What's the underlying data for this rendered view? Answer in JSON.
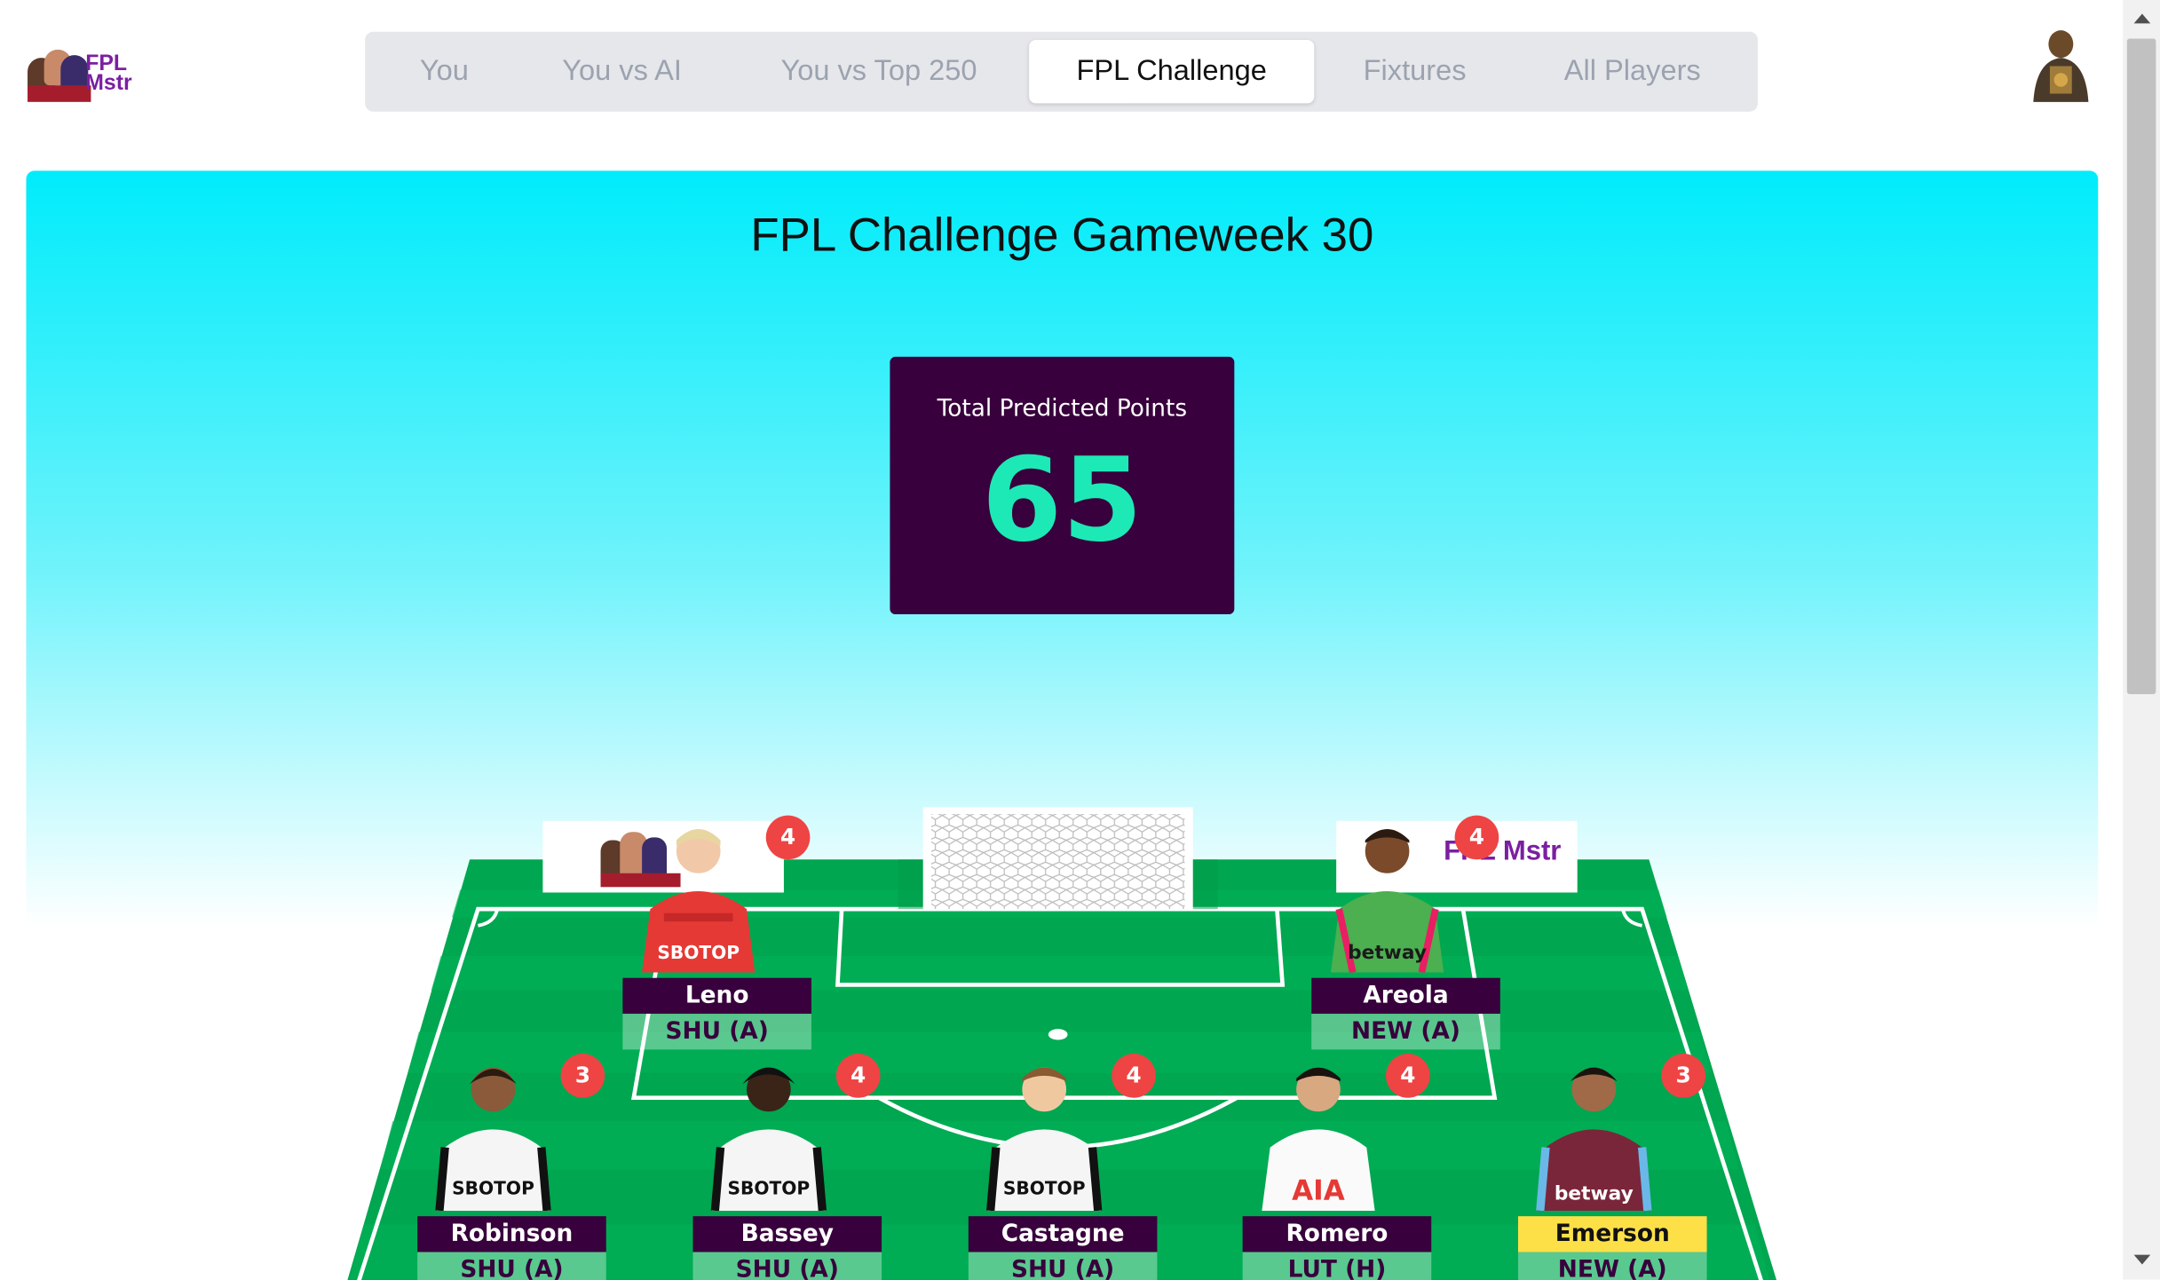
{
  "brand": {
    "logo_text": "FPL Mstr"
  },
  "nav": {
    "tabs": [
      {
        "label": "You",
        "active": false
      },
      {
        "label": "You vs AI",
        "active": false
      },
      {
        "label": "You vs Top 250",
        "active": false
      },
      {
        "label": "FPL Challenge",
        "active": true
      },
      {
        "label": "Fixtures",
        "active": false
      },
      {
        "label": "All Players",
        "active": false
      }
    ]
  },
  "header": {
    "title": "FPL Challenge Gameweek 30"
  },
  "summary": {
    "label": "Total Predicted Points",
    "value": "65"
  },
  "colors": {
    "accent_purple": "#38003c",
    "points_green": "#1de9b6",
    "pitch_green": "#00b150",
    "badge_red": "#ef4444",
    "captain_yellow": "#fde047"
  },
  "players": {
    "goalkeepers": [
      {
        "name": "Leno",
        "fixture": "SHU (A)",
        "points": "4",
        "kit": "red-gk",
        "captain": false
      },
      {
        "name": "Areola",
        "fixture": "NEW (A)",
        "points": "4",
        "kit": "green-gk",
        "captain": false
      }
    ],
    "defenders": [
      {
        "name": "Robinson",
        "fixture": "SHU (A)",
        "points": "3",
        "kit": "fulham",
        "captain": false
      },
      {
        "name": "Bassey",
        "fixture": "SHU (A)",
        "points": "4",
        "kit": "fulham",
        "captain": false
      },
      {
        "name": "Castagne",
        "fixture": "SHU (A)",
        "points": "4",
        "kit": "fulham",
        "captain": false
      },
      {
        "name": "Romero",
        "fixture": "LUT (H)",
        "points": "4",
        "kit": "spurs",
        "captain": false
      },
      {
        "name": "Emerson",
        "fixture": "NEW (A)",
        "points": "3",
        "kit": "westham",
        "captain": true
      }
    ]
  },
  "sponsors": {
    "fulham": "SBOTOP",
    "westham": "betway",
    "spurs": "AIA"
  }
}
